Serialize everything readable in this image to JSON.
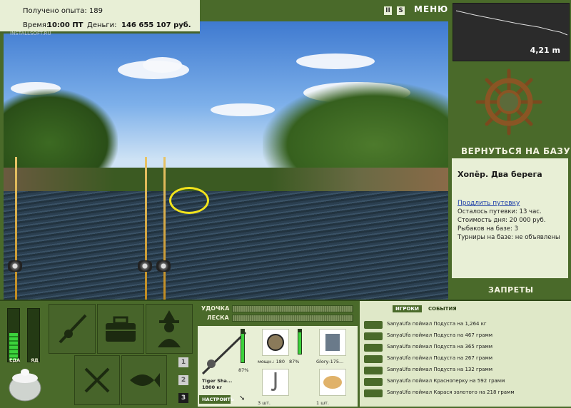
{
  "header": {
    "experience": "Получено опыта: 189",
    "time_label": "Время:",
    "time_value": "10:00 ПТ",
    "money_label": "Деньги:",
    "money_value": "146 655 107 руб.",
    "watermark": "INSTALLSOFT.RU",
    "pause": "II",
    "sound": "S",
    "menu": "МЕНЮ"
  },
  "depth": {
    "value": "4,21 m"
  },
  "base": {
    "return_label": "ВЕРНУТЬСЯ НА БАЗУ",
    "title": "Хопёр. Два берега",
    "extend_link": "Продлить путевку",
    "lines": [
      "Осталось путевки: 13 час.",
      "Стоимость дня: 20 000 руб.",
      "Рыбаков на базе: 3",
      "Турниры на базе: не объявлены"
    ],
    "bans_label": "ЗАПРЕТЫ"
  },
  "status": {
    "food_label": "ЕДА",
    "poison_label": "ЯД",
    "food_level": 0.55,
    "poison_level": 0.0
  },
  "slots": {
    "numbers": [
      "1",
      "2",
      "3"
    ],
    "active": 2
  },
  "tackle": {
    "rod_label": "УДОЧКА",
    "line_label": "ЛЕСКА",
    "rod_name": "Tiger Sha...",
    "rod_weight": "1800 кг",
    "rod_percent": "87%",
    "setup_label": "НАСТРОИТЬ",
    "reel_name": "мощн.: 180",
    "reel_percent": "87%",
    "line_name": "Glory-175...",
    "hook_count": "3 шт.",
    "bait_count": "1 шт."
  },
  "events": {
    "tabs": [
      "ИГРОКИ",
      "СОБЫТИЯ"
    ],
    "rows": [
      "SanyaUfa поймал Подуста на 1,264 кг",
      "SanyaUfa поймал Подуста на 467 грамм",
      "SanyaUfa поймал Подуста на 365 грамм",
      "SanyaUfa поймал Подуста на 267 грамм",
      "SanyaUfa поймал Подуста на 132 грамм",
      "SanyaUfa поймал Красноперку на 592 грамм",
      "SanyaUfa поймал Карася золотого на 218 грамм"
    ]
  },
  "icons": [
    "rod-icon",
    "tackle-box-icon",
    "fisherman-icon",
    "knife-fork-icon",
    "fish-icon",
    "pot-icon",
    "ship-wheel-icon"
  ]
}
